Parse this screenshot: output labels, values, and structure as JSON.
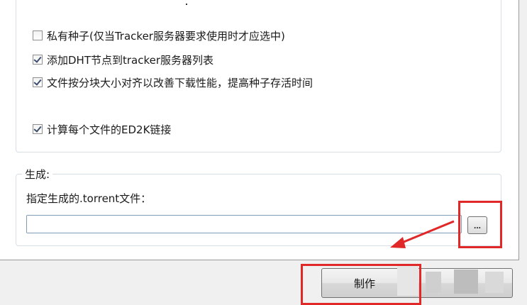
{
  "options": [
    {
      "label": "私有种子(仅当Tracker服务器要求使用时才应选中)",
      "checked": false
    },
    {
      "label": "添加DHT节点到tracker服务器列表",
      "checked": true
    },
    {
      "label": "文件按分块大小对齐以改善下载性能，提高种子存活时间",
      "checked": true
    },
    {
      "label": "计算每个文件的ED2K链接",
      "checked": true
    }
  ],
  "generate": {
    "legend": "生成:",
    "file_label": "指定生成的.torrent文件：",
    "file_value": "",
    "browse_label": "..."
  },
  "footer": {
    "make_label": "制作"
  },
  "colors": {
    "annotation_red": "#e02828",
    "input_border": "#7e9bb8",
    "group_border": "#d5dfe5"
  }
}
